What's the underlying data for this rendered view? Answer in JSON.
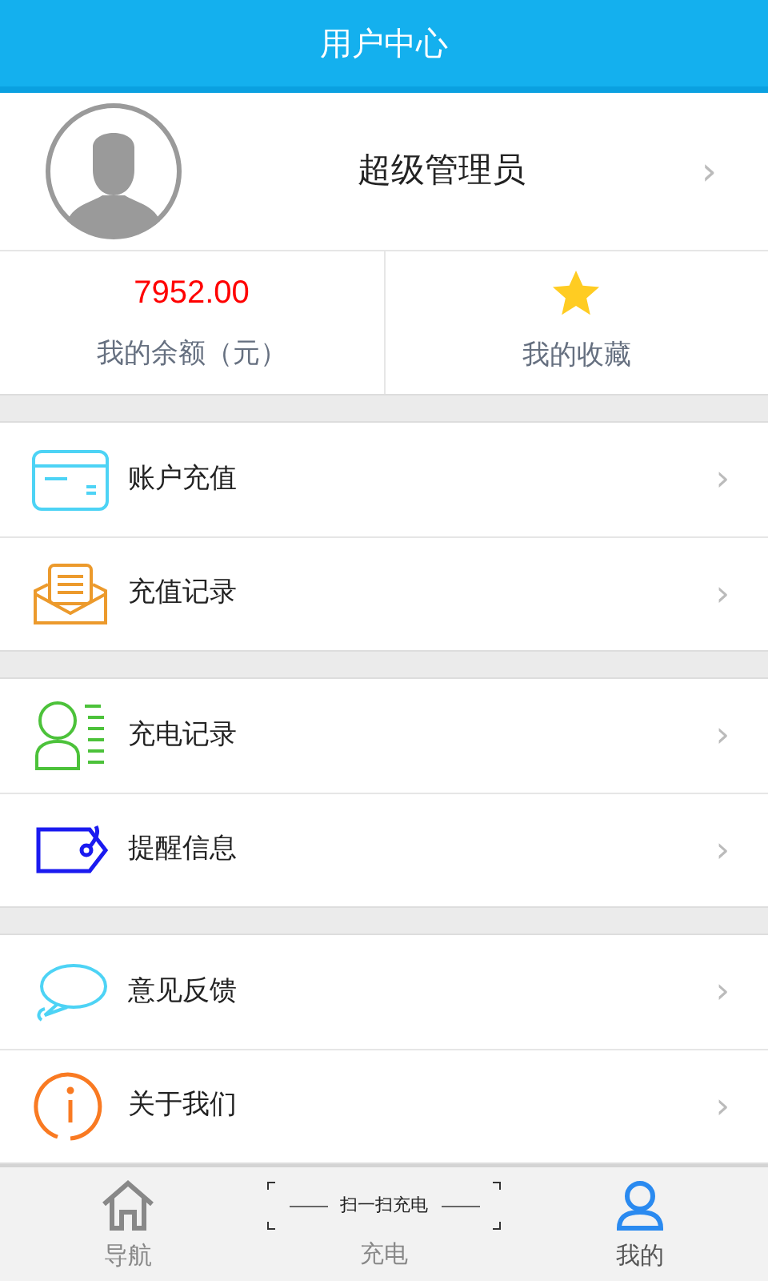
{
  "header": {
    "title": "用户中心"
  },
  "profile": {
    "name": "超级管理员",
    "chevron": "›"
  },
  "stats": [
    {
      "kind": "value",
      "value": "7952.00",
      "label": "我的余额（元）"
    },
    {
      "kind": "star",
      "label": "我的收藏"
    }
  ],
  "menu_groups": [
    [
      {
        "label": "账户充值",
        "chevron": "›"
      },
      {
        "label": "充值记录",
        "chevron": "›"
      }
    ],
    [
      {
        "label": "充电记录",
        "chevron": "›"
      },
      {
        "label": "提醒信息",
        "chevron": "›"
      }
    ],
    [
      {
        "label": "意见反馈",
        "chevron": "›"
      },
      {
        "label": "关于我们",
        "chevron": "›"
      }
    ]
  ],
  "bottom_nav": [
    {
      "kind": "icon",
      "label": "导航",
      "selected": false
    },
    {
      "kind": "scan",
      "scan_label": "扫一扫充电",
      "label": "充电",
      "selected": false
    },
    {
      "kind": "icon",
      "label": "我的",
      "selected": true
    }
  ]
}
